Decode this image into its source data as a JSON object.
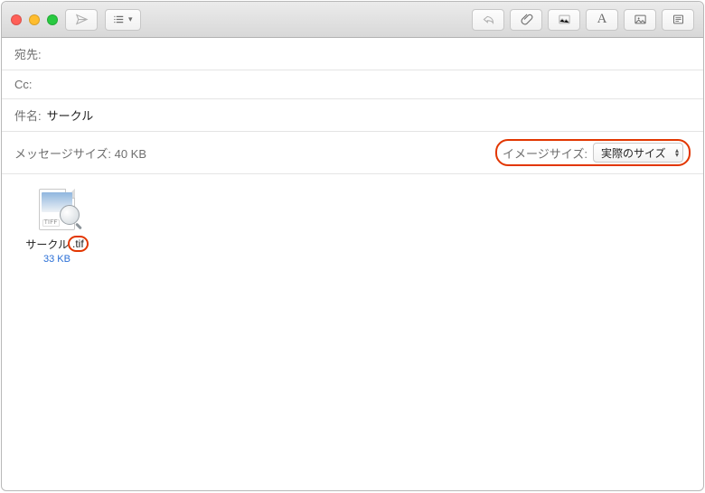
{
  "colors": {
    "annotation": "#e23600",
    "link": "#2a6fd6"
  },
  "toolbar": {
    "icons": {
      "send": "send-icon",
      "list": "list-icon",
      "reply": "reply-icon",
      "attach": "paperclip-icon",
      "insert_image": "insert-image-icon",
      "format": "format-icon",
      "photo_browser": "photo-browser-icon",
      "stationery": "stationery-icon"
    }
  },
  "fields": {
    "to_label": "宛先:",
    "to_value": "",
    "cc_label": "Cc:",
    "cc_value": "",
    "subject_label": "件名:",
    "subject_value": "サークル"
  },
  "message_size": {
    "label": "メッセージサイズ:",
    "value": "40 KB"
  },
  "image_size": {
    "label": "イメージサイズ:",
    "selected": "実際のサイズ"
  },
  "attachment": {
    "badge": "TIFF",
    "name_base": "サークル",
    "name_ext": ".tif",
    "size": "33 KB"
  }
}
